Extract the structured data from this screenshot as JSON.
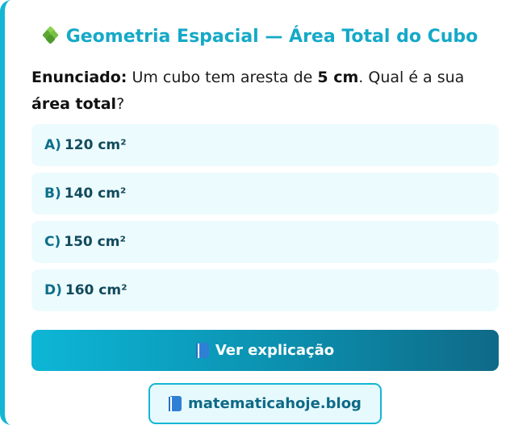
{
  "title": {
    "icon": "puzzle-icon",
    "text": "Geometria Espacial — Área Total do Cubo"
  },
  "statement": {
    "label": "Enunciado:",
    "part1": " Um cubo tem aresta de ",
    "edge": "5 cm",
    "part2": ". Qual é a sua ",
    "emphasis": "área total",
    "part3": "?"
  },
  "options": [
    {
      "letter": "A)",
      "value": "120 cm²"
    },
    {
      "letter": "B)",
      "value": "140 cm²"
    },
    {
      "letter": "C)",
      "value": "150 cm²"
    },
    {
      "letter": "D)",
      "value": "160 cm²"
    }
  ],
  "explain_button": {
    "icon": "book-icon",
    "label": "Ver explicação"
  },
  "blog_link": {
    "icon": "book-icon",
    "label": "matematicahoje.blog"
  },
  "colors": {
    "accent": "#13b6d3",
    "title": "#15a9c7",
    "option_bg": "#ecfbfe",
    "option_text": "#12617a",
    "button_gradient_start": "#0db6d6",
    "button_gradient_end": "#0e6a87"
  }
}
